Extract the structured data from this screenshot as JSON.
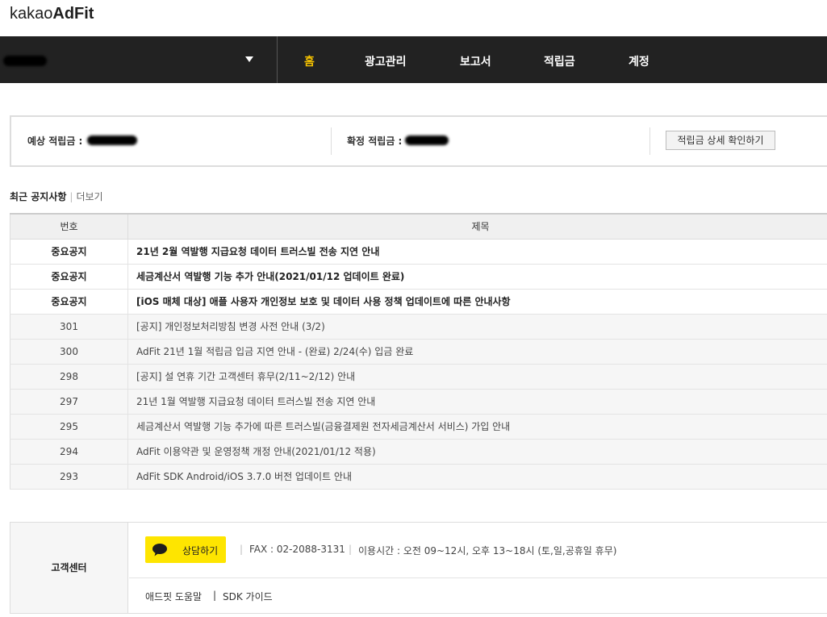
{
  "header": {
    "logo_light": "kakao",
    "logo_bold": "AdFit"
  },
  "gnb": {
    "menu": [
      {
        "label": "홈",
        "active": true
      },
      {
        "label": "광고관리",
        "active": false
      },
      {
        "label": "보고서",
        "active": false
      },
      {
        "label": "적립금",
        "active": false
      },
      {
        "label": "계정",
        "active": false
      }
    ]
  },
  "earnings": {
    "expected_label": "예상 적립금 :",
    "confirmed_label": "확정 적립금 :",
    "detail_button": "적립금 상세 확인하기"
  },
  "notices": {
    "title": "최근 공지사항",
    "more": "더보기",
    "columns": [
      "번호",
      "제목"
    ],
    "rows": [
      {
        "num": "중요공지",
        "title": "21년 2월 역발행 지급요청 데이터 트러스빌 전송 지연 안내",
        "important": true
      },
      {
        "num": "중요공지",
        "title": "세금계산서 역발행 기능 추가 안내(2021/01/12 업데이트 완료)",
        "important": true
      },
      {
        "num": "중요공지",
        "title": "[iOS 매체 대상] 애플 사용자 개인정보 보호 및 데이터 사용 정책 업데이트에 따른 안내사항",
        "important": true
      },
      {
        "num": "301",
        "title": "[공지] 개인정보처리방침 변경 사전 안내 (3/2)",
        "important": false
      },
      {
        "num": "300",
        "title": "AdFit 21년 1월 적립금 입금 지연 안내 - (완료) 2/24(수) 입금 완료",
        "important": false
      },
      {
        "num": "298",
        "title": "[공지] 설 연휴 기간 고객센터 휴무(2/11~2/12) 안내",
        "important": false
      },
      {
        "num": "297",
        "title": "21년 1월 역발행 지급요청 데이터 트러스빌 전송 지연 안내",
        "important": false
      },
      {
        "num": "295",
        "title": "세금계산서 역발행 기능 추가에 따른 트러스빌(금융결제원 전자세금계산서 서비스) 가입 안내",
        "important": false
      },
      {
        "num": "294",
        "title": "AdFit 이용약관 및 운영정책 개정 안내(2021/01/12 적용)",
        "important": false
      },
      {
        "num": "293",
        "title": "AdFit SDK Android/iOS 3.7.0 버전 업데이트 안내",
        "important": false
      }
    ]
  },
  "customer_center": {
    "label": "고객센터",
    "talk_button": "상담하기",
    "fax": "FAX :  02-2088-3131",
    "hours": "이용시간 :  오전 09~12시, 오후 13~18시 (토,일,공휴일 휴무)",
    "links": [
      "애드핏 도움말",
      "SDK 가이드"
    ]
  },
  "colors": {
    "nav_bg": "#222222",
    "nav_active": "#f5c200",
    "kakao_yellow": "#fee500"
  }
}
